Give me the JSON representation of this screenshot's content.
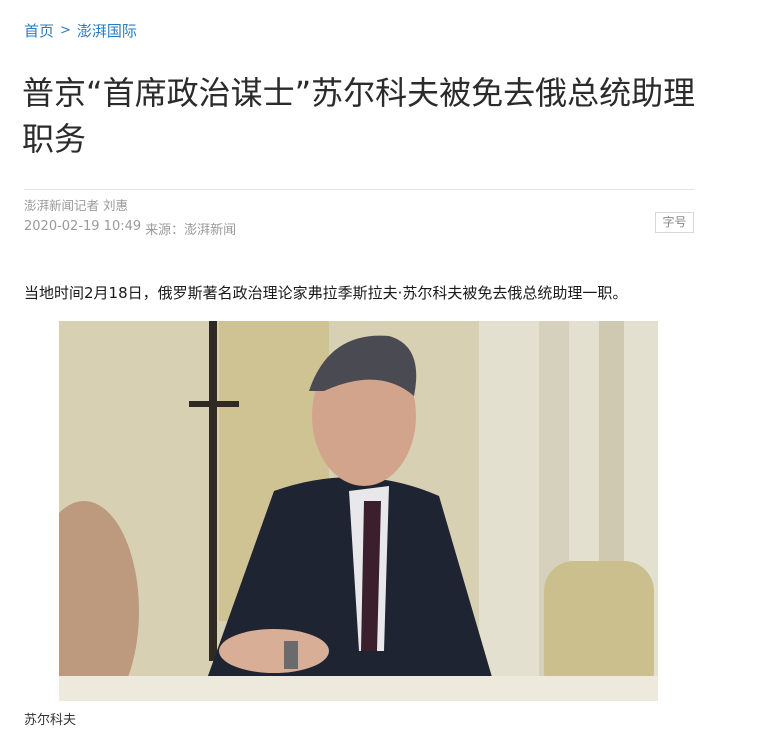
{
  "breadcrumb": {
    "home": "首页",
    "separator": ">",
    "channel": "澎湃国际"
  },
  "article": {
    "title": "普京“首席政治谋士”苏尔科夫被免去俄总统助理职务",
    "byline": "澎湃新闻记者 刘惠",
    "datetime": "2020-02-19 10:49",
    "source_label": "来源：",
    "source": "澎湃新闻",
    "font_size_button": "字号",
    "lead_paragraph": "当地时间2月18日，俄罗斯著名政治理论家弗拉季斯拉夫·苏尔科夫被免去俄总统助理一职。",
    "photo": {
      "icon": "portrait-photo",
      "caption": "苏尔科夫"
    }
  },
  "colors": {
    "link": "#2a7bbf",
    "title": "#2b2b2b",
    "meta": "#9a9a9a"
  }
}
